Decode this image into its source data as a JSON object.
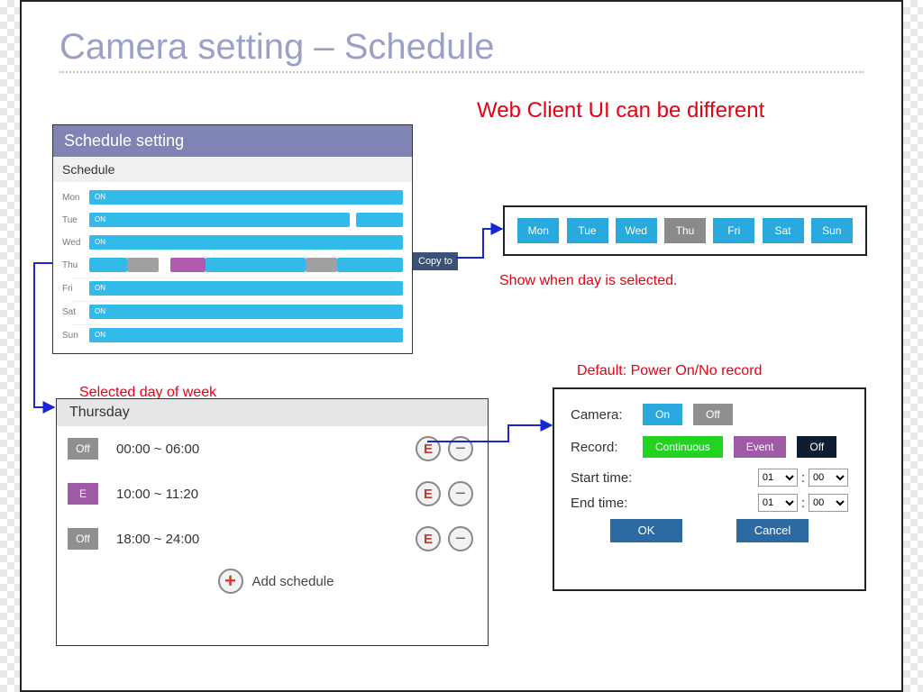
{
  "title": "Camera setting – Schedule",
  "web_note": "Web Client UI can be different",
  "panel": {
    "title": "Schedule setting",
    "subtitle": "Schedule",
    "days": [
      "Mon",
      "Tue",
      "Wed",
      "Thu",
      "Fri",
      "Sat",
      "Sun"
    ],
    "on_label": "ON"
  },
  "copy_to": "Copy to",
  "show_note": "Show when day is selected.",
  "selected_note": "Selected day of week",
  "detail": {
    "day": "Thursday",
    "slots": [
      {
        "tag": "Off",
        "kind": "off",
        "time": "00:00 ~ 06:00"
      },
      {
        "tag": "E",
        "kind": "ev",
        "time": "10:00 ~ 11:20"
      },
      {
        "tag": "Off",
        "kind": "off",
        "time": "18:00 ~ 24:00"
      }
    ],
    "edit_label": "E",
    "remove_label": "−",
    "add_label": "+",
    "add_text": "Add schedule"
  },
  "daysbar": {
    "days": [
      "Mon",
      "Tue",
      "Wed",
      "Thu",
      "Fri",
      "Sat",
      "Sun"
    ],
    "selected": "Thu"
  },
  "default_note": "Default: Power On/No record",
  "dialog": {
    "camera_label": "Camera:",
    "on": "On",
    "off": "Off",
    "record_label": "Record:",
    "continuous": "Continuous",
    "event": "Event",
    "roff": "Off",
    "start_label": "Start time:",
    "end_label": "End time:",
    "hour": "01",
    "min": "00",
    "ok": "OK",
    "cancel": "Cancel"
  }
}
